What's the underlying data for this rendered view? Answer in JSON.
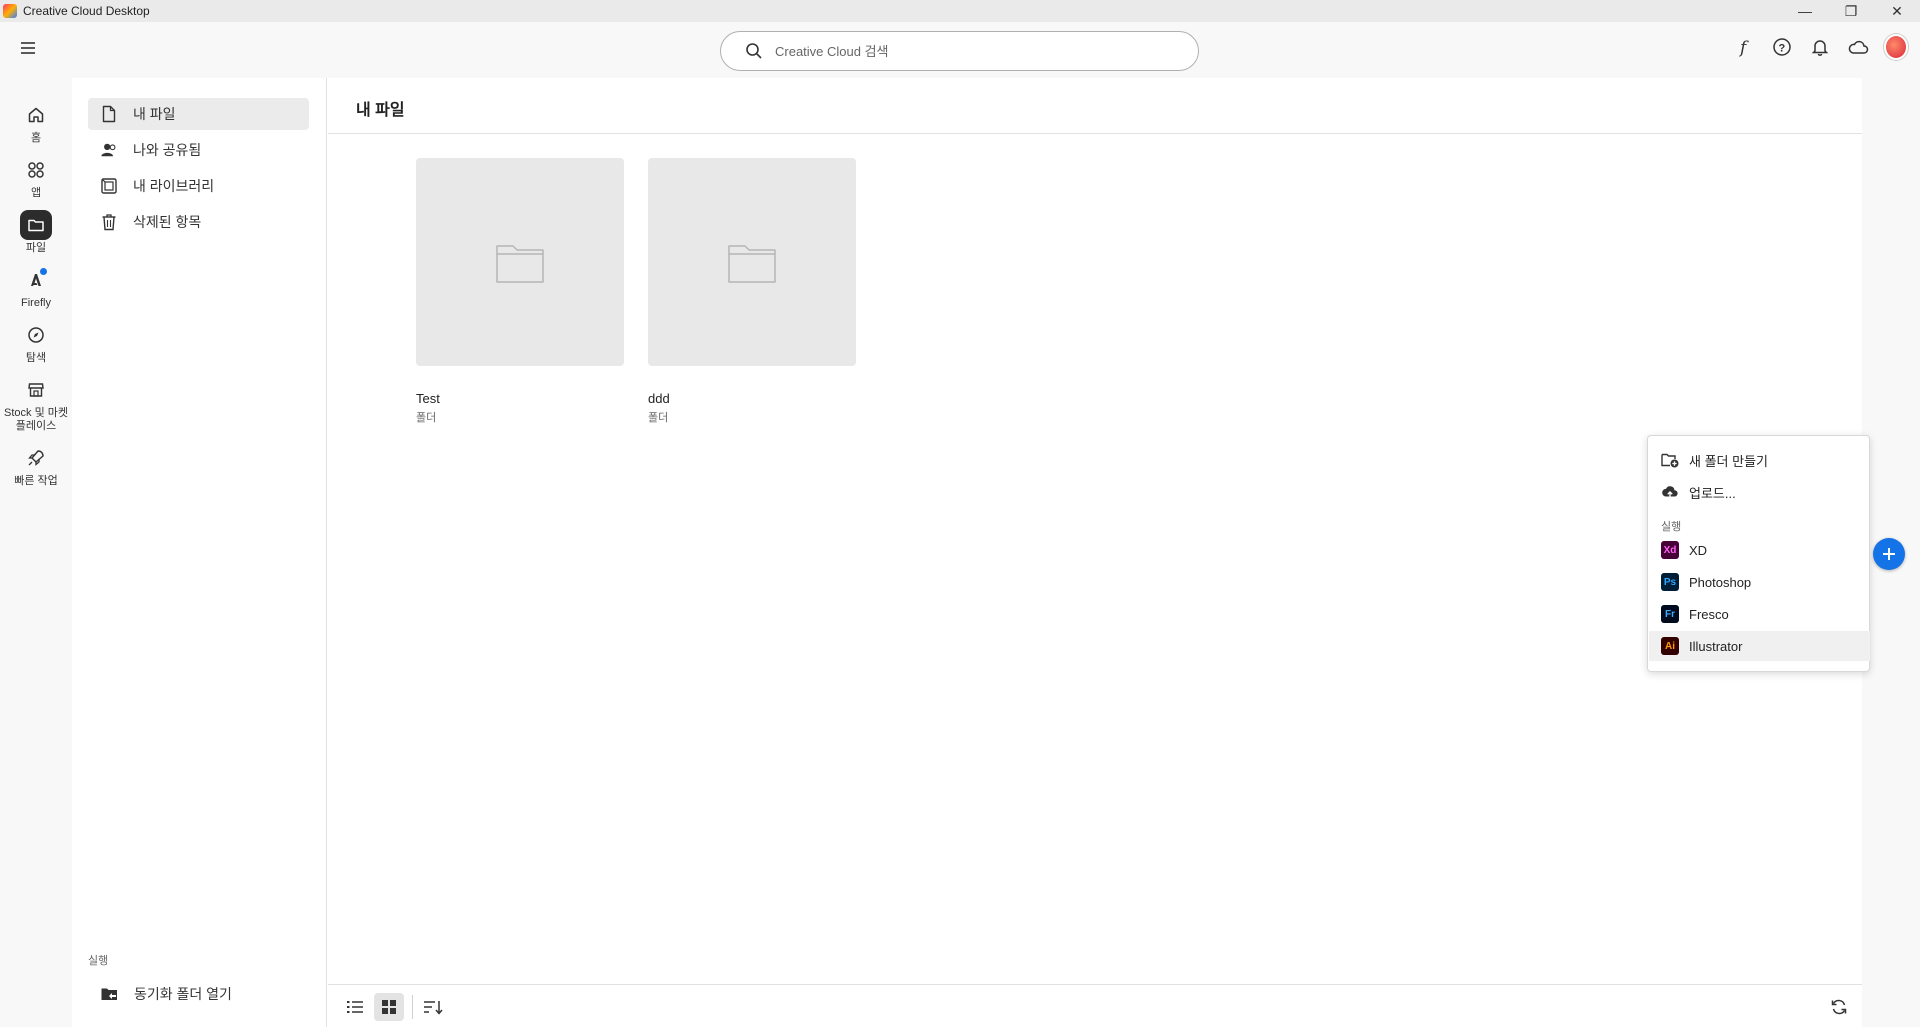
{
  "window": {
    "title": "Creative Cloud Desktop",
    "controls": [
      "minimize",
      "restore",
      "close"
    ]
  },
  "search": {
    "placeholder": "Creative Cloud 검색"
  },
  "top_icons": [
    "fonts-icon",
    "help-icon",
    "bell-icon",
    "cloud-icon",
    "avatar"
  ],
  "rail": {
    "items": [
      {
        "label": "홈",
        "icon": "home-icon"
      },
      {
        "label": "앱",
        "icon": "apps-icon"
      },
      {
        "label": "파일",
        "icon": "folder-icon",
        "active": true
      },
      {
        "label": "Firefly",
        "icon": "firefly-icon",
        "badge": true
      },
      {
        "label": "탐색",
        "icon": "discover-icon"
      },
      {
        "label": "Stock 및 마켓플레이스",
        "icon": "stock-icon"
      },
      {
        "label": "빠른 작업",
        "icon": "rocket-icon"
      }
    ]
  },
  "sidebar": {
    "items": [
      {
        "label": "내 파일",
        "icon": "file-icon",
        "active": true
      },
      {
        "label": "나와 공유됨",
        "icon": "people-icon"
      },
      {
        "label": "내 라이브러리",
        "icon": "library-icon"
      },
      {
        "label": "삭제된 항목",
        "icon": "trash-icon"
      }
    ],
    "section_label": "실행",
    "sync_label": "동기화 폴더 열기"
  },
  "main": {
    "title": "내 파일",
    "folders": [
      {
        "name": "Test",
        "type": "폴더"
      },
      {
        "name": "ddd",
        "type": "폴더"
      }
    ]
  },
  "menu": {
    "items": [
      {
        "label": "새 폴더 만들기",
        "icon": "new-folder-icon"
      },
      {
        "label": "업로드...",
        "icon": "upload-icon"
      }
    ],
    "section_label": "실행",
    "apps": [
      {
        "label": "XD",
        "abbr": "Xd",
        "bg": "#470137",
        "fg": "#ff61f6"
      },
      {
        "label": "Photoshop",
        "abbr": "Ps",
        "bg": "#001e36",
        "fg": "#31a8ff"
      },
      {
        "label": "Fresco",
        "abbr": "Fr",
        "bg": "#000b1d",
        "fg": "#3caeff"
      },
      {
        "label": "Illustrator",
        "abbr": "Ai",
        "bg": "#330000",
        "fg": "#ff9a00",
        "hover": true
      }
    ]
  },
  "bottom_bar": {
    "buttons": [
      "list-view-icon",
      "grid-view-icon",
      "sort-icon",
      "refresh-icon"
    ],
    "active_view": "grid"
  },
  "colors": {
    "accent": "#1473e6",
    "rail_active": "#2c2c2c"
  }
}
